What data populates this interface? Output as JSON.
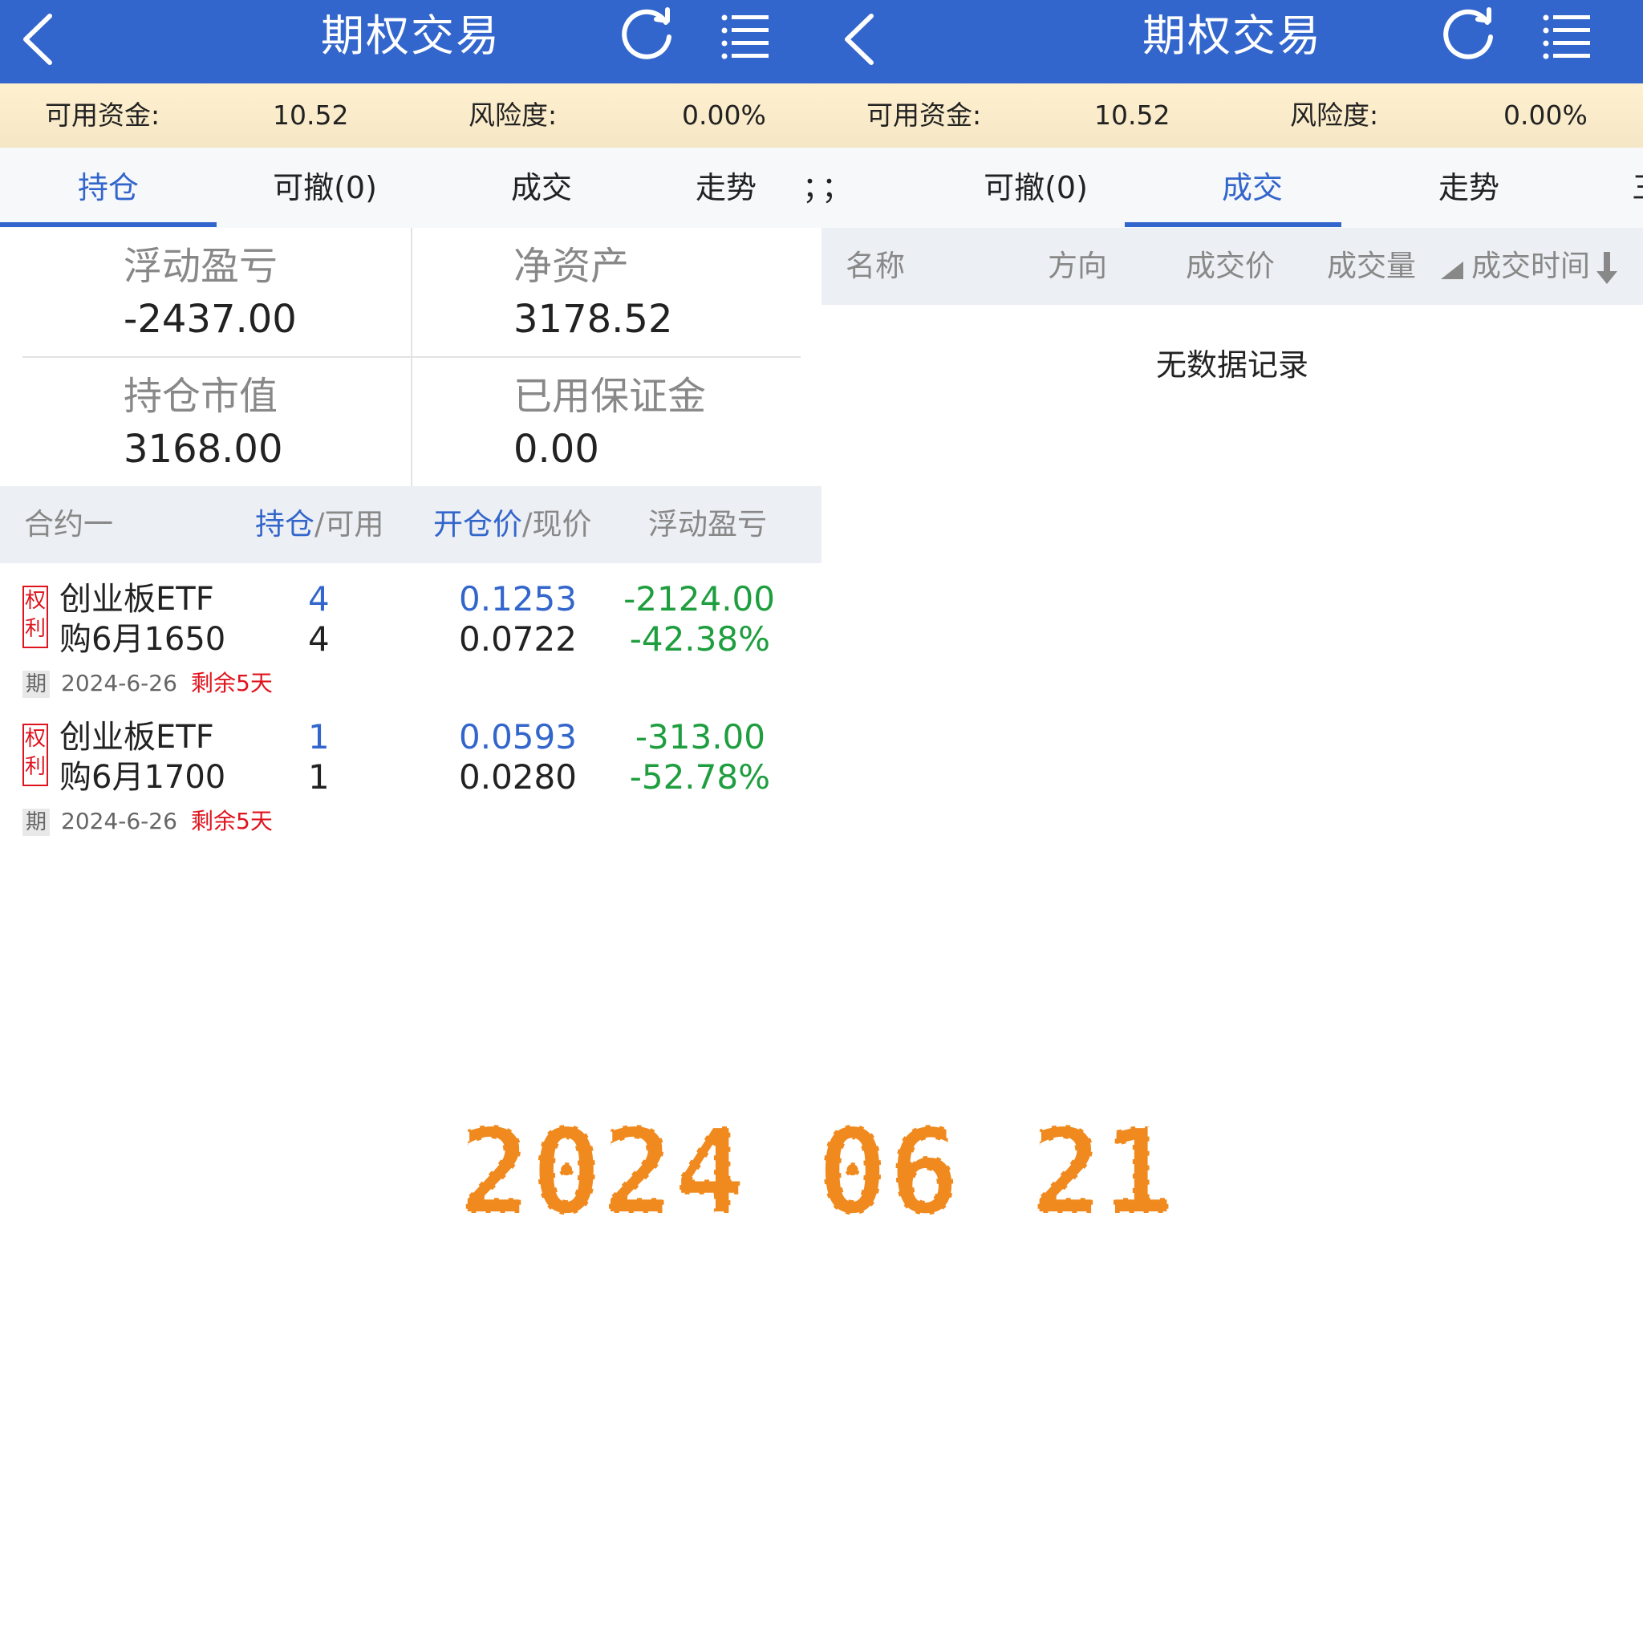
{
  "header": {
    "title": "期权交易"
  },
  "funds": {
    "available_label": "可用资金:",
    "available_value": "10.52",
    "risk_label": "风险度:",
    "risk_value": "0.00%"
  },
  "left": {
    "tabs": [
      "持仓",
      "可撤(0)",
      "成交",
      "走势"
    ],
    "tab_edge": "；",
    "summary": {
      "float_pl_label": "浮动盈亏",
      "float_pl_value": "-2437.00",
      "net_assets_label": "净资产",
      "net_assets_value": "3178.52",
      "position_value_label": "持仓市值",
      "position_value_value": "3168.00",
      "margin_label": "已用保证金",
      "margin_value": "0.00"
    },
    "table_headers": {
      "contract": "合约一",
      "position": "持仓",
      "position_sep": "/可用",
      "open_price": "开仓价",
      "open_price_sep": "/现价",
      "float_pl": "浮动盈亏"
    },
    "rows": [
      {
        "tag": "权利",
        "name_line1": "创业板ETF",
        "name_line2": "购6月1650",
        "position": "4",
        "available": "4",
        "open_price": "0.1253",
        "current_price": "0.0722",
        "pl": "-2124.00",
        "pl_pct": "-42.38%",
        "period_label": "期",
        "expiry": "2024-6-26",
        "remaining": "剩余5天"
      },
      {
        "tag": "权利",
        "name_line1": "创业板ETF",
        "name_line2": "购6月1700",
        "position": "1",
        "available": "1",
        "open_price": "0.0593",
        "current_price": "0.0280",
        "pl": "-313.00",
        "pl_pct": "-52.78%",
        "period_label": "期",
        "expiry": "2024-6-26",
        "remaining": "剩余5天"
      }
    ]
  },
  "right": {
    "tab_edge_left": "；",
    "tabs": [
      "可撤(0)",
      "成交",
      "走势"
    ],
    "tab_edge_right": "三",
    "table_headers": {
      "name": "名称",
      "direction": "方向",
      "price": "成交价",
      "volume": "成交量",
      "time": "成交时间"
    },
    "empty_text": "无数据记录"
  },
  "date_stamp": {
    "text": "2024 06 21",
    "color": "#f08a1e"
  },
  "colors": {
    "brand_blue": "#3366cc",
    "loss_green": "#1e9e3e",
    "alert_red": "#e0141e"
  }
}
